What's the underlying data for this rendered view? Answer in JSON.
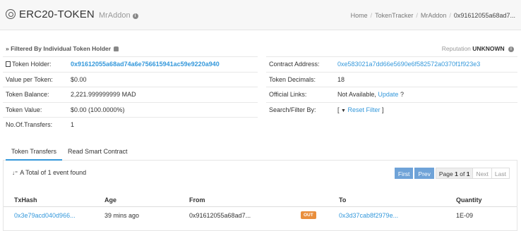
{
  "header": {
    "title": "ERC20-TOKEN",
    "subtitle": "MrAddon",
    "info_icon": "i"
  },
  "breadcrumb": [
    "Home",
    "TokenTracker",
    "MrAddon",
    "0x91612055a68ad7..."
  ],
  "filter": {
    "label": "» Filtered By Individual Token Holder",
    "reputation_label": "Reputation",
    "reputation_value": "UNKNOWN"
  },
  "left_rows": [
    {
      "label": "Token Holder:",
      "value": "0x91612055a68ad74a6e756615941ac59e9220a940"
    },
    {
      "label": "Value per Token:",
      "value": "$0.00"
    },
    {
      "label": "Token Balance:",
      "value": "2,221.999999999 MAD"
    },
    {
      "label": "Token Value:",
      "value": "$0.00 (100.0000%)"
    },
    {
      "label": "No.Of.Transfers:",
      "value": "1"
    }
  ],
  "right_rows": [
    {
      "label": "Contract Address:",
      "value": "0xe583021a7dd66e5690e6f582572a0370f1f923e3"
    },
    {
      "label": "Token Decimals:",
      "value": "18"
    },
    {
      "label": "Official Links:",
      "value": "Not Available,",
      "link": "Update",
      "suffix": "?"
    },
    {
      "label": "Search/Filter By:",
      "prefix": "[",
      "link": "Reset Filter",
      "suffix": "]"
    }
  ],
  "tabs": [
    {
      "label": "Token Transfers",
      "active": true
    },
    {
      "label": "Read Smart Contract",
      "active": false
    }
  ],
  "summary": "A Total of 1 event found",
  "pager": {
    "first": "First",
    "prev": "Prev",
    "page_label": "Page",
    "page_current": "1",
    "page_of": "of",
    "page_total": "1",
    "next": "Next",
    "last": "Last"
  },
  "table": {
    "columns": [
      "TxHash",
      "Age",
      "From",
      "",
      "To",
      "Quantity"
    ],
    "rows": [
      {
        "txhash": "0x3e79acd040d966...",
        "age": "39 mins ago",
        "from": "0x91612055a68ad7...",
        "direction": "OUT",
        "to": "0x3d37cab8f2979e...",
        "quantity": "1E-09"
      }
    ]
  },
  "colors": {
    "link": "#3498db",
    "out_badge": "#e98e3c",
    "pager_blue": "#6fa3d8"
  }
}
